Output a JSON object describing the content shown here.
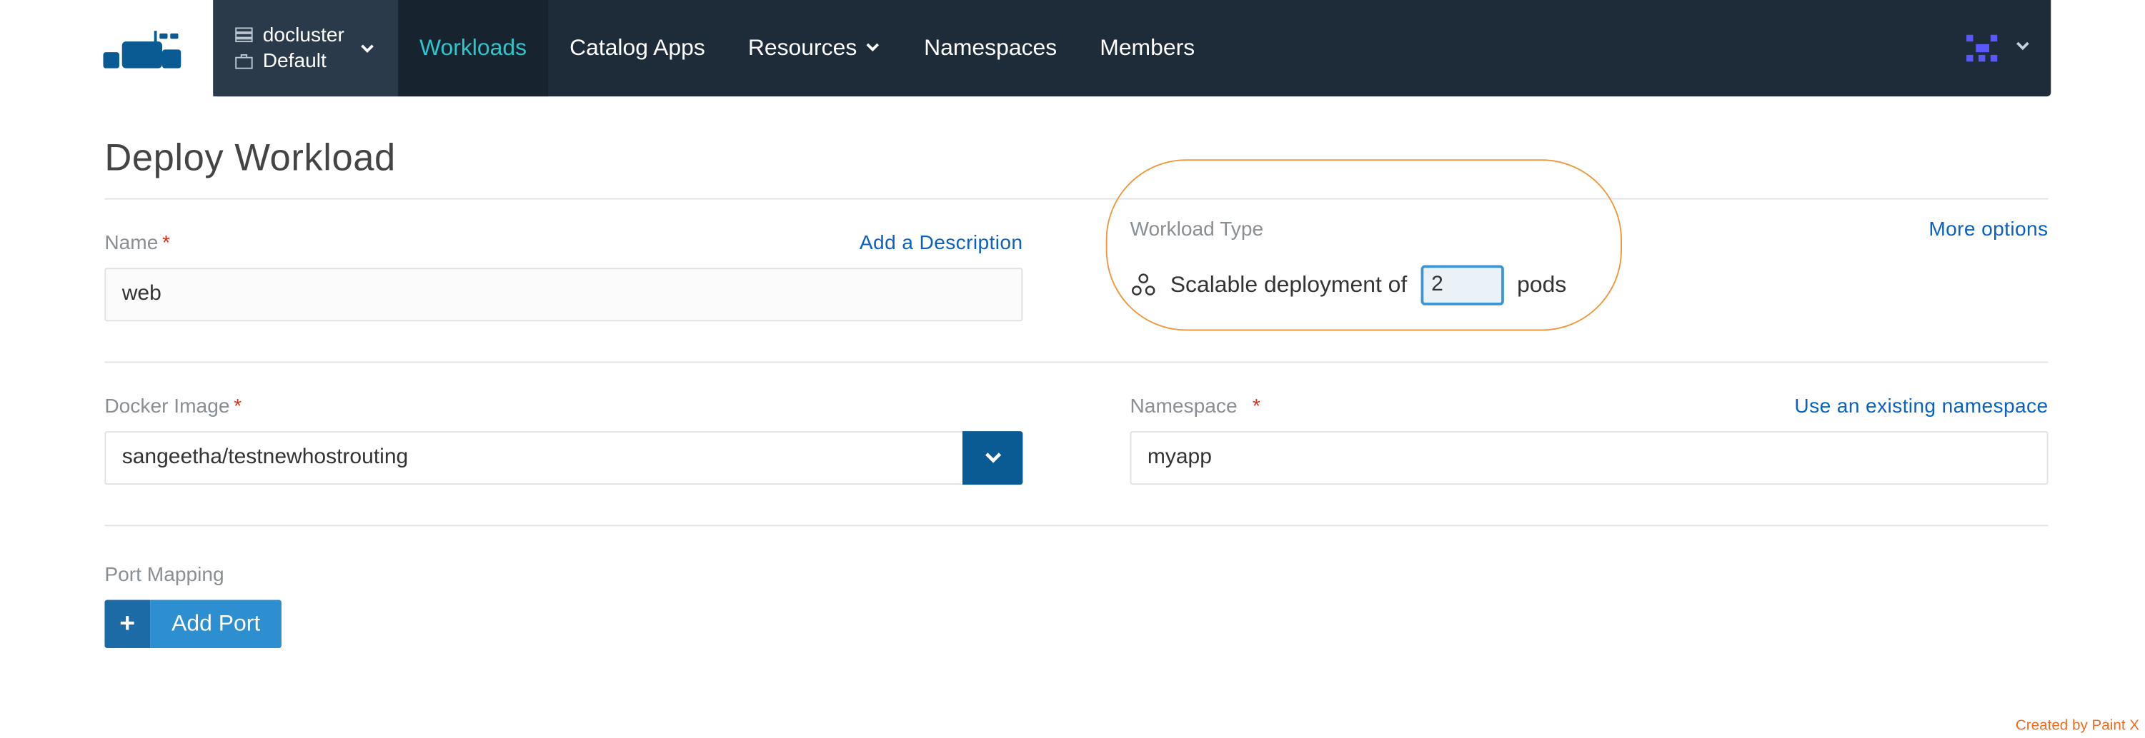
{
  "nav": {
    "cluster_name": "docluster",
    "project_name": "Default",
    "tabs": {
      "workloads": "Workloads",
      "catalog": "Catalog Apps",
      "resources": "Resources",
      "namespaces": "Namespaces",
      "members": "Members"
    }
  },
  "page": {
    "title": "Deploy Workload"
  },
  "form": {
    "name_label": "Name",
    "name_value": "web",
    "add_description": "Add a Description",
    "workload_type_label": "Workload Type",
    "more_options": "More options",
    "workload_type_prefix": "Scalable deployment of",
    "workload_pod_count": "2",
    "workload_type_suffix": "pods",
    "docker_image_label": "Docker Image",
    "docker_image_value": "sangeetha/testnewhostrouting",
    "namespace_label": "Namespace",
    "namespace_link": "Use an existing namespace",
    "namespace_value": "myapp",
    "port_mapping_label": "Port Mapping",
    "add_port_label": "Add Port"
  },
  "watermark": "Created by Paint X"
}
